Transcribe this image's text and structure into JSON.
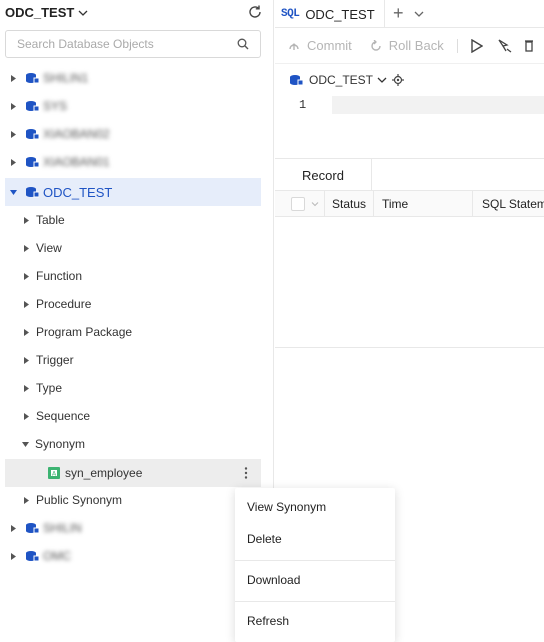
{
  "left_panel": {
    "db_title": "ODC_TEST",
    "search_placeholder": "Search Database Objects",
    "databases": [
      {
        "label": "SHILIN1",
        "blurred": true
      },
      {
        "label": "SYS",
        "blurred": true
      },
      {
        "label": "XIAOBAN02",
        "blurred": true
      },
      {
        "label": "XIAOBAN01",
        "blurred": true
      },
      {
        "label": "ODC_TEST",
        "blurred": false,
        "expanded": true
      }
    ],
    "object_types": [
      "Table",
      "View",
      "Function",
      "Procedure",
      "Program Package",
      "Trigger",
      "Type",
      "Sequence",
      "Synonym"
    ],
    "synonym_item": "syn_employee",
    "public_synonym": "Public Synonym",
    "databases_after": [
      {
        "label": "SHILIN",
        "blurred": true
      },
      {
        "label": "OMC",
        "blurred": true
      }
    ]
  },
  "tabs": {
    "active_icon": "SQL",
    "active_title": "ODC_TEST"
  },
  "toolbar": {
    "commit": "Commit",
    "rollback": "Roll Back"
  },
  "editor": {
    "db_selector": "ODC_TEST",
    "line_number": "1"
  },
  "results": {
    "tab_record": "Record",
    "columns": [
      "Status",
      "Time",
      "SQL Statem"
    ]
  },
  "context_menu": {
    "items": [
      "View Synonym",
      "Delete",
      "Download",
      "Refresh"
    ]
  },
  "colors": {
    "accent": "#1f54c4",
    "selected_bg": "#e6edfa",
    "synonym_icon": "#3cb371"
  }
}
